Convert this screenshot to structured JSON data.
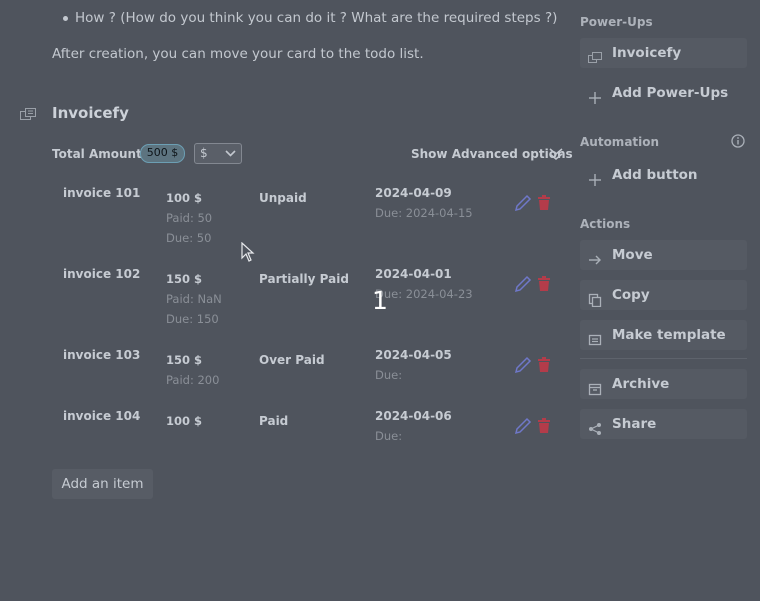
{
  "description": {
    "bullet_text": "How ? (How do you think you can do it ? What are the required steps ?)",
    "after_text": "After creation, you can move your card to the todo list."
  },
  "powerup": {
    "title": "Invoicefy",
    "total_label": "Total Amount:",
    "total_value": "500 $",
    "currency": "$",
    "advanced_label": "Show Advanced options",
    "invoices": [
      {
        "name": "invoice 101",
        "amount": "100 $",
        "paid": "Paid: 50",
        "due_amount": "Due: 50",
        "status": "Unpaid",
        "date": "2024-04-09",
        "due_date": "Due: 2024-04-15"
      },
      {
        "name": "invoice 102",
        "amount": "150 $",
        "paid": "Paid: NaN",
        "due_amount": "Due: 150",
        "status": "Partially Paid",
        "date": "2024-04-01",
        "due_date": "Due: 2024-04-23"
      },
      {
        "name": "invoice 103",
        "amount": "150 $",
        "paid": "Paid: 200",
        "due_amount": "",
        "status": "Over Paid",
        "date": "2024-04-05",
        "due_date": "Due:"
      },
      {
        "name": "invoice 104",
        "amount": "100 $",
        "paid": "",
        "due_amount": "",
        "status": "Paid",
        "date": "2024-04-06",
        "due_date": "Due:"
      }
    ],
    "add_item_label": "Add an item",
    "step_marker": "1"
  },
  "sidebar": {
    "powerups_heading": "Power-Ups",
    "powerup_item": "Invoicefy",
    "add_powerups": "Add Power-Ups",
    "automation_heading": "Automation",
    "add_button": "Add button",
    "actions_heading": "Actions",
    "move": "Move",
    "copy": "Copy",
    "make_template": "Make template",
    "archive": "Archive",
    "share": "Share"
  },
  "colors": {
    "background": "#4f545d",
    "edit_icon": "#6f78c9",
    "delete_icon": "#b33c4a",
    "amount_badge_border": "#6c9fb4"
  }
}
